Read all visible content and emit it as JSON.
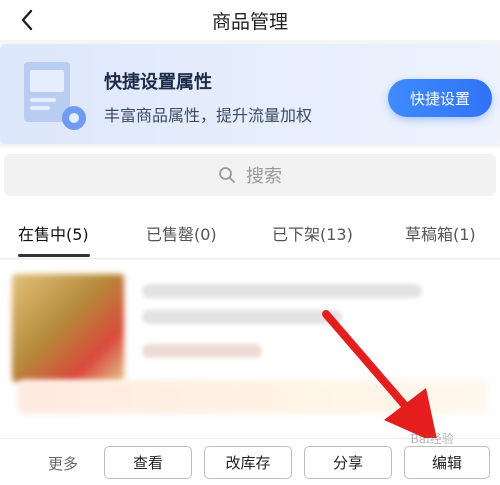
{
  "header": {
    "title": "商品管理"
  },
  "banner": {
    "title": "快捷设置属性",
    "subtitle": "丰富商品属性，提升流量加权",
    "button_label": "快捷设置"
  },
  "search": {
    "placeholder": "搜索"
  },
  "tabs": [
    {
      "label": "在售中(5)",
      "active": true
    },
    {
      "label": "已售罄(0)",
      "active": false
    },
    {
      "label": "已下架(13)",
      "active": false
    },
    {
      "label": "草稿箱(1)",
      "active": false
    }
  ],
  "actions": {
    "more": "更多",
    "view": "查看",
    "stock": "改库存",
    "share": "分享",
    "edit": "编辑"
  },
  "watermark": "Bai经验",
  "colors": {
    "accent": "#2f73f5",
    "arrow": "#e51d1d"
  }
}
